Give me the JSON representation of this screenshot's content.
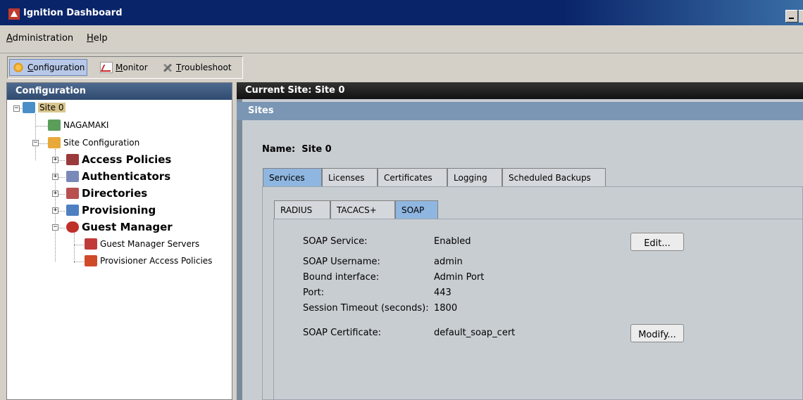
{
  "window": {
    "title": "Ignition Dashboard"
  },
  "menu": {
    "administration": "dministration",
    "administration_mn": "A",
    "help": "elp",
    "help_mn": "H"
  },
  "toolbar": {
    "configuration": "onfiguration",
    "configuration_mn": "C",
    "monitor": "onitor",
    "monitor_mn": "M",
    "troubleshoot": "roubleshoot",
    "troubleshoot_mn": "T"
  },
  "left_panel": {
    "title": "Configuration",
    "tree": {
      "site": "Site 0",
      "appliance": "NAGAMAKI",
      "site_configuration": "Site Configuration",
      "access_policies": "Access Policies",
      "authenticators": "Authenticators",
      "directories": "Directories",
      "provisioning": "Provisioning",
      "guest_manager": "Guest Manager",
      "guest_manager_servers": "Guest Manager Servers",
      "provisioner_access_policies": "Provisioner Access Policies"
    }
  },
  "header": {
    "current_site": "Current Site:  Site 0",
    "section": "Sites"
  },
  "site": {
    "name_label": "Name:",
    "name_value": "Site 0"
  },
  "tabs": [
    "Services",
    "Licenses",
    "Certificates",
    "Logging",
    "Scheduled Backups"
  ],
  "subtabs": [
    "RADIUS",
    "TACACS+",
    "SOAP"
  ],
  "soap": {
    "service_label": "SOAP Service:",
    "service_value": "Enabled",
    "username_label": "SOAP Username:",
    "username_value": "admin",
    "interface_label": "Bound interface:",
    "interface_value": "Admin Port",
    "port_label": "Port:",
    "port_value": "443",
    "timeout_label": "Session Timeout (seconds):",
    "timeout_value": "1800",
    "cert_label": "SOAP Certificate:",
    "cert_value": "default_soap_cert",
    "edit_button": "Edit...",
    "modify_button": "Modify..."
  },
  "colors": {
    "title_bar": "#0a246a",
    "active_tab": "#8fb6e0",
    "panel_header": "#3f5a7f",
    "sites_bar": "#7a96b4"
  }
}
